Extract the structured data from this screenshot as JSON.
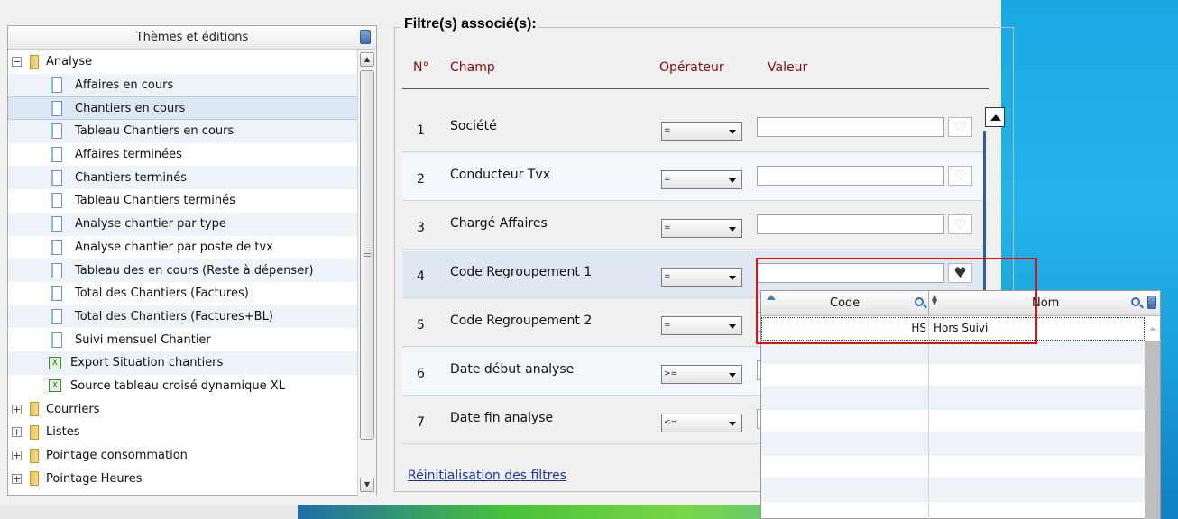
{
  "tree": {
    "header": "Thèmes et éditions",
    "items": [
      {
        "label": "Analyse",
        "type": "folder",
        "expander": "−"
      },
      {
        "label": "Affaires en cours",
        "type": "doc"
      },
      {
        "label": "Chantiers en cours",
        "type": "doc",
        "selected": true
      },
      {
        "label": "Tableau Chantiers en cours",
        "type": "doc"
      },
      {
        "label": "Affaires terminées",
        "type": "doc"
      },
      {
        "label": "Chantiers terminés",
        "type": "doc"
      },
      {
        "label": "Tableau Chantiers terminés",
        "type": "doc"
      },
      {
        "label": "Analyse chantier par type",
        "type": "doc"
      },
      {
        "label": "Analyse chantier par poste de tvx",
        "type": "doc"
      },
      {
        "label": "Tableau des en cours (Reste à dépenser)",
        "type": "doc"
      },
      {
        "label": "Total des Chantiers (Factures)",
        "type": "doc"
      },
      {
        "label": "Total des Chantiers (Factures+BL)",
        "type": "doc"
      },
      {
        "label": "Suivi mensuel Chantier",
        "type": "doc"
      },
      {
        "label": "Export Situation chantiers",
        "type": "xl"
      },
      {
        "label": "Source tableau croisé dynamique XL",
        "type": "xl"
      },
      {
        "label": "Courriers",
        "type": "folder",
        "expander": "+"
      },
      {
        "label": "Listes",
        "type": "folder",
        "expander": "+"
      },
      {
        "label": "Pointage consommation",
        "type": "folder",
        "expander": "+"
      },
      {
        "label": "Pointage Heures",
        "type": "folder",
        "expander": "+"
      }
    ]
  },
  "filters": {
    "legend": "Filtre(s) associé(s):",
    "headers": {
      "num": "N°",
      "champ": "Champ",
      "operateur": "Opérateur",
      "valeur": "Valeur"
    },
    "rows": [
      {
        "num": "1",
        "label": "Société",
        "op": "=",
        "value": ""
      },
      {
        "num": "2",
        "label": "Conducteur Tvx",
        "op": "=",
        "value": ""
      },
      {
        "num": "3",
        "label": "Chargé Affaires",
        "op": "=",
        "value": ""
      },
      {
        "num": "4",
        "label": "Code Regroupement 1",
        "op": "=",
        "value": ""
      },
      {
        "num": "5",
        "label": "Code Regroupement 2",
        "op": "=",
        "value": ""
      },
      {
        "num": "6",
        "label": "Date début analyse",
        "op": ">=",
        "value": ""
      },
      {
        "num": "7",
        "label": "Date fin analyse",
        "op": "<=",
        "value": ""
      }
    ],
    "reset_link": "Réinitialisation des filtres"
  },
  "lookup": {
    "col_code": "Code",
    "col_nom": "Nom",
    "rows": [
      {
        "code": "HS",
        "nom": "Hors Suivi"
      }
    ],
    "empty_rows": 8
  },
  "colors": {
    "accent_red_text": "#8b0a0a",
    "link": "#1a36a8",
    "highlight_box": "#e01010",
    "selected_row": "#dce7f3"
  }
}
